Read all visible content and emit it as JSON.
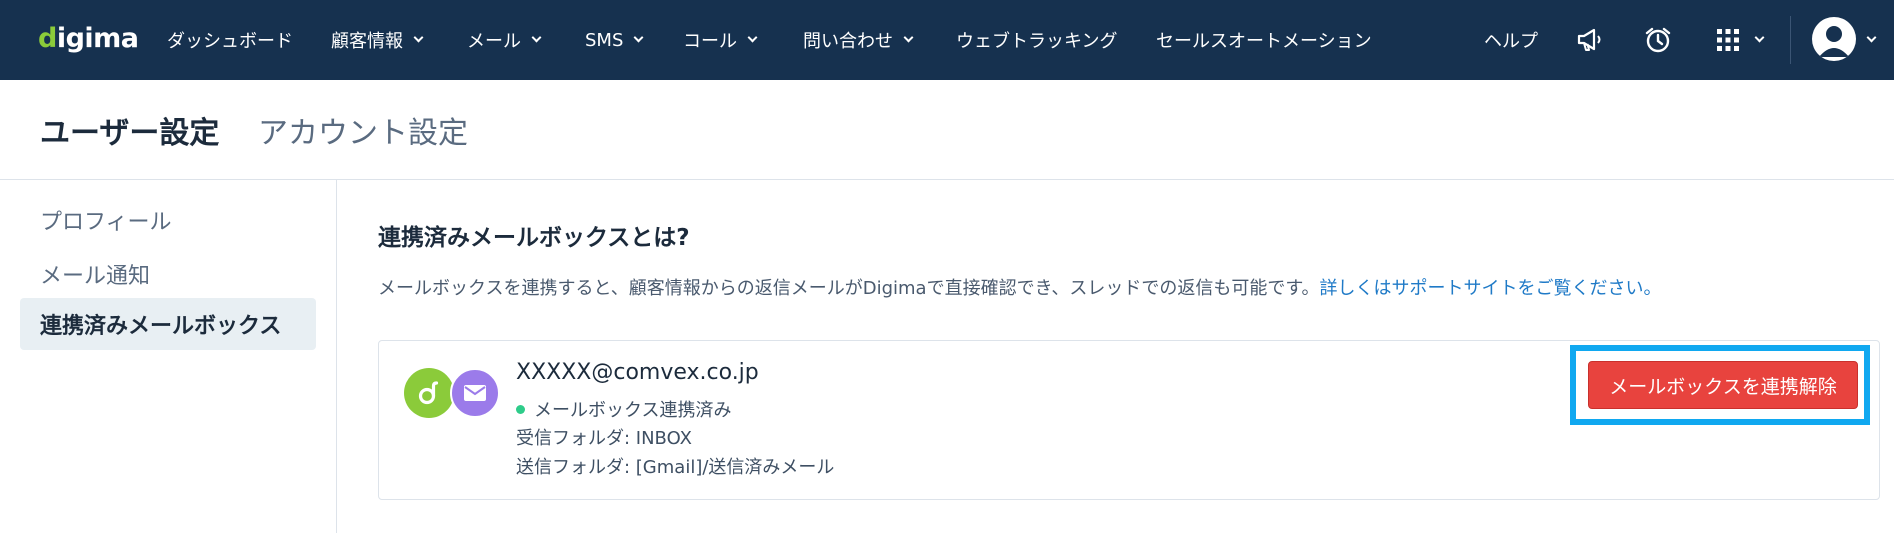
{
  "brand": {
    "logo_prefix": "d",
    "logo_rest": "igima"
  },
  "nav": {
    "items": [
      {
        "label": "ダッシュボード"
      },
      {
        "label": "顧客情報"
      },
      {
        "label": "メール"
      },
      {
        "label": "SMS"
      },
      {
        "label": "コール"
      },
      {
        "label": "問い合わせ"
      },
      {
        "label": "ウェブトラッキング"
      },
      {
        "label": "セールスオートメーション"
      }
    ],
    "help": "ヘルプ",
    "icons": [
      "megaphone-icon",
      "alarm-clock-icon",
      "apps-grid-icon",
      "user-avatar-icon"
    ]
  },
  "header": {
    "tabs": [
      {
        "label": "ユーザー設定"
      },
      {
        "label": "アカウント設定"
      }
    ]
  },
  "sidebar": {
    "items": [
      {
        "label": "プロフィール"
      },
      {
        "label": "メール通知"
      },
      {
        "label": "連携済みメールボックス"
      }
    ]
  },
  "main": {
    "title": "連携済みメールボックスとは?",
    "description": "メールボックスを連携すると、顧客情報からの返信メールがDigimaで直接確認でき、スレッドでの返信も可能です。",
    "link": "詳しくはサポートサイトをご覧ください。",
    "mailbox": {
      "email": "XXXXX@comvex.co.jp",
      "status": "メールボックス連携済み",
      "inbox": "受信フォルダ: INBOX",
      "sent": "送信フォルダ: [Gmail]/送信済みメール",
      "disconnect_label": "メールボックスを連携解除"
    }
  },
  "colors": {
    "navbar": "#16314f",
    "brand_green": "#8bcb3a",
    "mail_purple": "#9b7bea",
    "danger": "#e8433e",
    "highlight": "#10a8f0",
    "link": "#1f7ac7",
    "status_ok": "#2ecc8a"
  }
}
